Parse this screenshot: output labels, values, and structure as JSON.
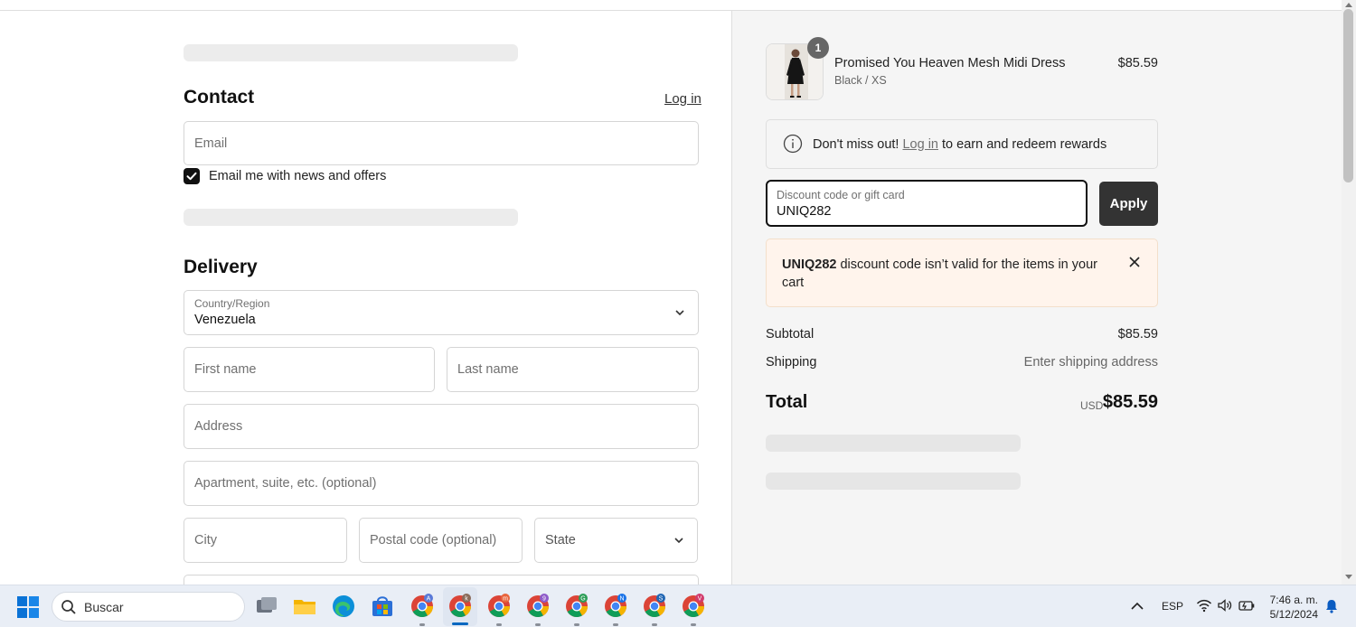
{
  "contact": {
    "heading": "Contact",
    "login_link": "Log in",
    "email_placeholder": "Email",
    "news_checkbox_label": "Email me with news and offers",
    "news_checked": true
  },
  "delivery": {
    "heading": "Delivery",
    "country_label": "Country/Region",
    "country_value": "Venezuela",
    "first_name_placeholder": "First name",
    "last_name_placeholder": "Last name",
    "address_placeholder": "Address",
    "apartment_placeholder": "Apartment, suite, etc. (optional)",
    "city_placeholder": "City",
    "postal_placeholder": "Postal code (optional)",
    "state_placeholder": "State"
  },
  "order": {
    "item": {
      "quantity": "1",
      "name": "Promised You Heaven Mesh Midi Dress",
      "variant": "Black / XS",
      "price": "$85.59"
    },
    "rewards": {
      "prefix": "Don't miss out!",
      "link": "Log in",
      "suffix": "to earn and redeem rewards"
    },
    "discount": {
      "label": "Discount code or gift card",
      "value": "UNIQ282",
      "apply_label": "Apply"
    },
    "error": {
      "code": "UNIQ282",
      "message": "discount code isn’t valid for the items in your cart"
    },
    "subtotal_label": "Subtotal",
    "subtotal_value": "$85.59",
    "shipping_label": "Shipping",
    "shipping_value": "Enter shipping address",
    "total_label": "Total",
    "total_currency": "USD",
    "total_value": "$85.59"
  },
  "taskbar": {
    "search_label": "Buscar",
    "language": "ESP",
    "time": "7:46 a. m.",
    "date": "5/12/2024",
    "profile_badges": [
      "A",
      "k",
      "m",
      "9",
      "G",
      "N",
      "S",
      "V"
    ]
  },
  "colors": {
    "accent_dark": "#333333",
    "error_bg": "#fff4ec",
    "sidebar_bg": "#f5f5f5"
  }
}
